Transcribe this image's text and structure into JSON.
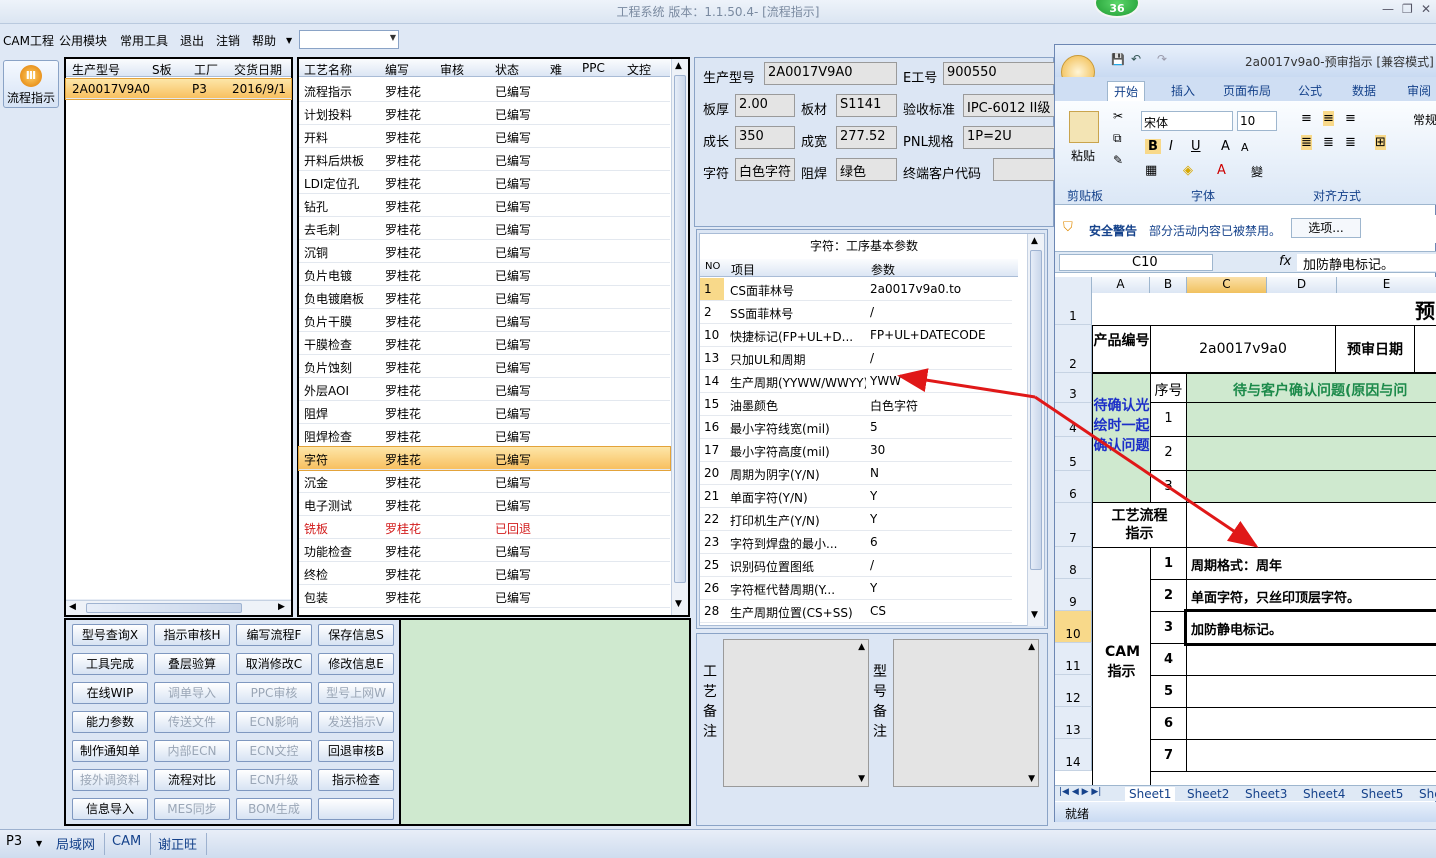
{
  "window": {
    "title": "工程系统 版本：1.1.50.4- [流程指示]",
    "badge": "36"
  },
  "menu": [
    "CAM工程",
    "公用模块",
    "常用工具",
    "退出",
    "注销",
    "帮助"
  ],
  "left_button": {
    "label": "流程指示"
  },
  "order_grid": {
    "headers": [
      "生产型号",
      "S板",
      "工厂",
      "交货日期"
    ],
    "rows": [
      [
        "2A0017V9A0",
        "",
        "P3",
        "2016/9/1"
      ]
    ]
  },
  "process_grid": {
    "headers": [
      "工艺名称",
      "编写",
      "审核",
      "状态",
      "难",
      "PPC",
      "文控"
    ],
    "rows": [
      [
        "流程指示",
        "罗桂花",
        "已编写"
      ],
      [
        "计划投料",
        "罗桂花",
        "已编写"
      ],
      [
        "开料",
        "罗桂花",
        "已编写"
      ],
      [
        "开料后烘板",
        "罗桂花",
        "已编写"
      ],
      [
        "LDI定位孔",
        "罗桂花",
        "已编写"
      ],
      [
        "钻孔",
        "罗桂花",
        "已编写"
      ],
      [
        "去毛刺",
        "罗桂花",
        "已编写"
      ],
      [
        "沉铜",
        "罗桂花",
        "已编写"
      ],
      [
        "负片电镀",
        "罗桂花",
        "已编写"
      ],
      [
        "负电镀磨板",
        "罗桂花",
        "已编写"
      ],
      [
        "负片干膜",
        "罗桂花",
        "已编写"
      ],
      [
        "干膜检查",
        "罗桂花",
        "已编写"
      ],
      [
        "负片蚀刻",
        "罗桂花",
        "已编写"
      ],
      [
        "外层AOI",
        "罗桂花",
        "已编写"
      ],
      [
        "阻焊",
        "罗桂花",
        "已编写"
      ],
      [
        "阻焊检查",
        "罗桂花",
        "已编写"
      ],
      [
        "字符",
        "罗桂花",
        "已编写"
      ],
      [
        "沉金",
        "罗桂花",
        "已编写"
      ],
      [
        "电子测试",
        "罗桂花",
        "已编写"
      ],
      [
        "铣板",
        "罗桂花",
        "已回退"
      ],
      [
        "功能检查",
        "罗桂花",
        "已编写"
      ],
      [
        "终检",
        "罗桂花",
        "已编写"
      ],
      [
        "包装",
        "罗桂花",
        "已编写"
      ]
    ]
  },
  "buttons": [
    [
      "型号查询X",
      "指示审核H",
      "编写流程F",
      "保存信息S"
    ],
    [
      "工具完成",
      "叠层验算",
      "取消修改C",
      "修改信息E"
    ],
    [
      "在线WIP",
      "调单导入",
      "PPC审核",
      "型号上网W"
    ],
    [
      "能力参数",
      "传送文件",
      "ECN影响",
      "发送指示V"
    ],
    [
      "制作通知单",
      "内部ECN",
      "ECN文控",
      "回退审核B"
    ],
    [
      "接外调资料",
      "流程对比",
      "ECN升级",
      "指示检查"
    ],
    [
      "信息导入",
      "MES同步",
      "BOM生成",
      ""
    ]
  ],
  "info": {
    "model_label": "生产型号",
    "model": "2A0017V9A0",
    "eno_label": "E工号",
    "eno": "900550",
    "thick_label": "板厚",
    "thick": "2.00",
    "mat_label": "板材",
    "mat": "S1141",
    "std_label": "验收标准",
    "std": "IPC-6012 II级",
    "len_label": "成长",
    "len": "350",
    "wid_label": "成宽",
    "wid": "277.52",
    "pnl_label": "PNL规格",
    "pnl": "1P=2U",
    "char_label": "字符",
    "char": "白色字符",
    "mask_label": "阻焊",
    "mask": "绿色",
    "cust_label": "终端客户代码",
    "cust": ""
  },
  "params": {
    "title": "字符：工序基本参数",
    "headers": [
      "NO",
      "项目",
      "参数"
    ],
    "rows": [
      [
        "1",
        "CS面菲林号",
        "2a0017v9a0.to"
      ],
      [
        "2",
        "SS面菲林号",
        "/"
      ],
      [
        "10",
        "快捷标记(FP+UL+D...",
        "FP+UL+DATECODE"
      ],
      [
        "13",
        "只加UL和周期",
        "/"
      ],
      [
        "14",
        "生产周期(YYWW/WWYY)",
        "YWW"
      ],
      [
        "15",
        "油墨颜色",
        "白色字符"
      ],
      [
        "16",
        "最小字符线宽(mil)",
        "5"
      ],
      [
        "17",
        "最小字符高度(mil)",
        "30"
      ],
      [
        "20",
        "周期为阴字(Y/N)",
        "N"
      ],
      [
        "21",
        "单面字符(Y/N)",
        "Y"
      ],
      [
        "22",
        "打印机生产(Y/N)",
        "Y"
      ],
      [
        "23",
        "字符到焊盘的最小...",
        "6"
      ],
      [
        "25",
        "识别码位置图纸",
        "/"
      ],
      [
        "26",
        "字符框代替周期(Y...",
        "Y"
      ],
      [
        "28",
        "生产周期位置(CS+SS)",
        "CS"
      ]
    ]
  },
  "remarks": {
    "process": "工艺备注",
    "model": "型号备注"
  },
  "excel": {
    "title": "2a0017v9a0-预审指示 [兼容模式]",
    "tabs": [
      "开始",
      "插入",
      "页面布局",
      "公式",
      "数据",
      "审阅"
    ],
    "font": "宋体",
    "size": "10",
    "wrap": "常规",
    "groups": [
      "剪贴板",
      "字体",
      "对齐方式"
    ],
    "paste": "粘贴",
    "security_title": "安全警告",
    "security_msg": "部分活动内容已被禁用。",
    "options": "选项...",
    "cellref": "C10",
    "formula": "加防静电标记。",
    "cols": [
      "A",
      "B",
      "C",
      "D",
      "E"
    ],
    "heading": "预",
    "product_label": "产品编号",
    "product": "2a0017v9a0",
    "predate_label": "预审日期",
    "seq_label": "序号",
    "confirm_head": "待与客户确认问题(原因与问",
    "pending_label": "待确认光绘时一起确认问题",
    "flow_label": "工艺流程指示",
    "cam_label": "CAM指示",
    "items": [
      "周期格式：周年",
      "单面字符，只丝印顶层字符。",
      "加防静电标记。"
    ],
    "sheets": [
      "Sheet1",
      "Sheet2",
      "Sheet3",
      "Sheet4",
      "Sheet5",
      "She"
    ],
    "ready": "就绪"
  },
  "status": {
    "site": "P3",
    "net": "局域网",
    "mod": "CAM",
    "user": "谢正旺"
  },
  "colors": {
    "selected": "#f8c060",
    "green": "#cfe9cf",
    "arrow": "#e01818"
  }
}
